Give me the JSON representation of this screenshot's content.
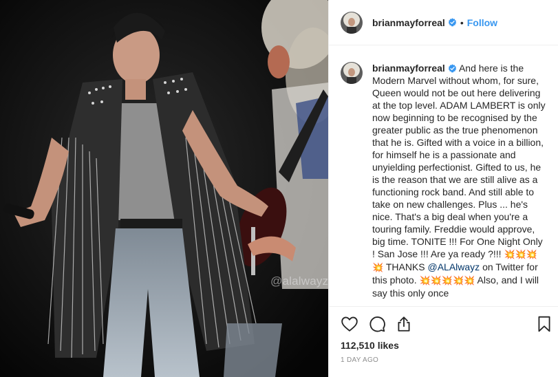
{
  "header": {
    "username": "brianmayforreal",
    "separator": "•",
    "follow_label": "Follow"
  },
  "photo": {
    "watermark": "@alalwayz"
  },
  "caption": {
    "username": "brianmayforreal",
    "text_1": " And here is the Modern Marvel without whom, for sure, Queen would not be out here delivering at the top level. ADAM LAMBERT is only now beginning to be recognised by the greater public as the true phenomenon that he is. Gifted with a voice in a billion, for himself he is a passionate and unyielding perfectionist. Gifted to us, he is the reason that we are still alive as a functioning rock band. And still able to take on new challenges. Plus ... he's nice. That's a big deal when you're a touring family. Freddie would approve, big time. TONITE !!! For One Night Only ! San Jose !!! Are ya ready ?!!! ",
    "emoji_1": "💥💥💥💥",
    "text_2": " THANKS ",
    "mention": "@ALAlwayz",
    "text_3": " on Twitter for this photo. ",
    "emoji_2": "💥💥💥💥💥",
    "text_4": " Also, and I will say this only once"
  },
  "actions": {
    "like_icon": "heart-icon",
    "comment_icon": "comment-icon",
    "share_icon": "share-icon",
    "save_icon": "bookmark-icon"
  },
  "likes": "112,510 likes",
  "time": "1 DAY AGO",
  "colors": {
    "link": "#3897f0",
    "mention": "#003569",
    "verified": "#3897f0",
    "text": "#262626",
    "muted": "#8e8e8e"
  }
}
